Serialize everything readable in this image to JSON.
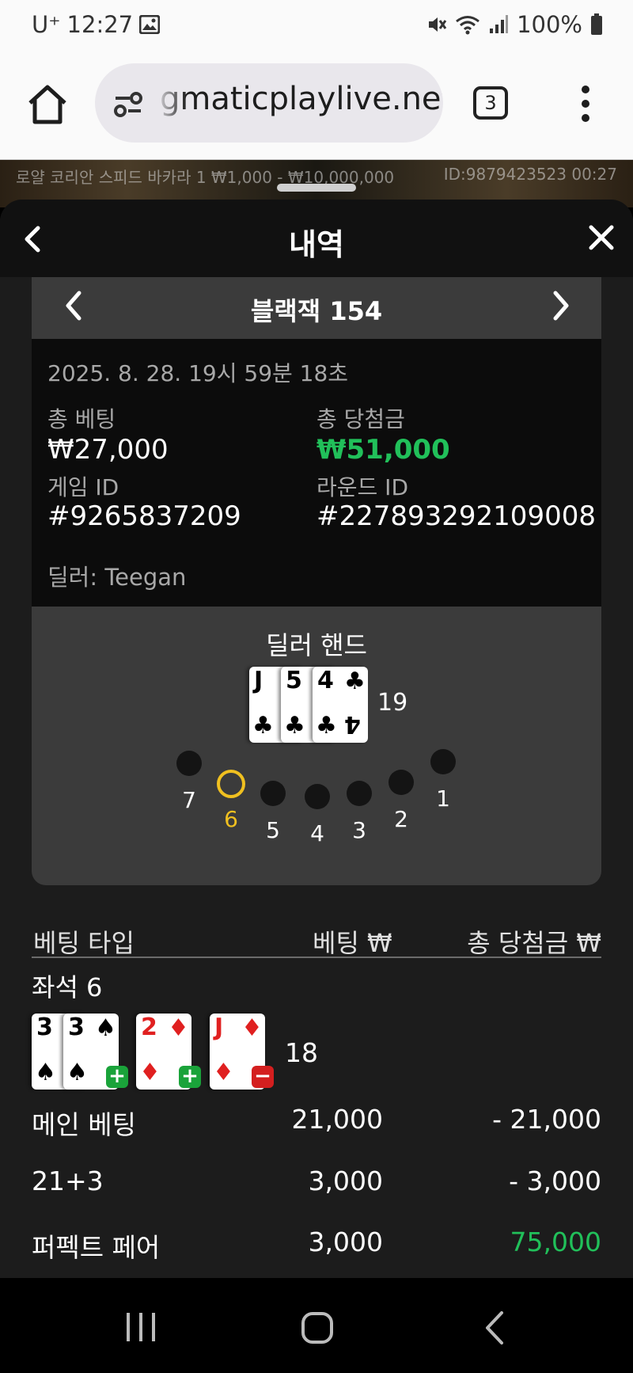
{
  "status_bar": {
    "carrier": "U⁺",
    "time": "12:27",
    "battery": "100%"
  },
  "browser": {
    "url": "gmaticplaylive.net",
    "tab_count": "3"
  },
  "game_backdrop": {
    "table_info": "로얄 코리안 스피드 바카라 1 ₩1,000 - ₩10,000,000",
    "session_id": "ID:9879423523  00:27"
  },
  "sheet": {
    "title": "내역",
    "game_name": "블랙잭 154"
  },
  "round_info": {
    "datetime": "2025. 8. 28. 19시 59분 18초",
    "total_bet_label": "총 베팅",
    "total_bet_value": "₩27,000",
    "total_win_label": "총 당첨금",
    "total_win_value": "₩51,000",
    "game_id_label": "게임 ID",
    "game_id_value": "#9265837209",
    "round_id_label": "라운드 ID",
    "round_id_value": "#227893292109008",
    "dealer": "딜러: Teegan"
  },
  "dealer_hand": {
    "title": "딜러 핸드",
    "total": "19",
    "cards": [
      {
        "rank": "J",
        "suit": "♣",
        "color": "black"
      },
      {
        "rank": "5",
        "suit": "♣",
        "color": "black"
      },
      {
        "rank": "4",
        "suit": "♣",
        "color": "black"
      }
    ]
  },
  "seats": {
    "labels": [
      "7",
      "6",
      "5",
      "4",
      "3",
      "2",
      "1"
    ],
    "active": "6"
  },
  "bets_table": {
    "headers": {
      "type": "베팅 타입",
      "bet": "베팅 ₩",
      "win": "총 당첨금 ₩"
    },
    "seat_label": "좌석 6",
    "player_total": "18",
    "player_cards": [
      {
        "rank": "3",
        "suit": "♠",
        "color": "black"
      },
      {
        "rank": "3",
        "suit": "♠",
        "color": "black",
        "action": "+"
      },
      {
        "rank": "2",
        "suit": "♦",
        "color": "red",
        "action": "+"
      },
      {
        "rank": "J",
        "suit": "♦",
        "color": "red",
        "action": "−"
      }
    ],
    "rows": [
      {
        "type": "메인 베팅",
        "bet": "21,000",
        "win": "- 21,000"
      },
      {
        "type": "21+3",
        "bet": "3,000",
        "win": "- 3,000"
      },
      {
        "type": "퍼펙트 페어",
        "bet": "3,000",
        "win": "75,000"
      }
    ]
  },
  "colors": {
    "win_green": "#21c05a",
    "active_seat": "#f0c020",
    "panel": "#3b3b3b"
  }
}
